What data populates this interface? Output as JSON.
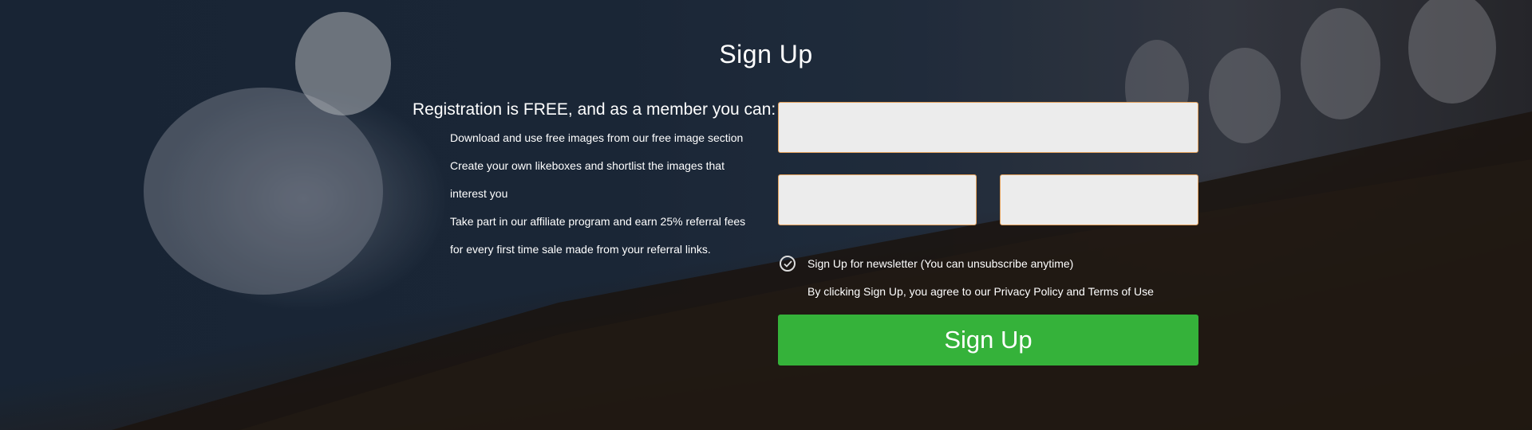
{
  "page": {
    "title": "Sign Up"
  },
  "benefits": {
    "heading": "Registration is FREE, and as a member you can:",
    "items": [
      "Download and use free images from our free image section",
      "Create your own likeboxes and shortlist the images that interest you",
      "Take part in our affiliate program and earn 25% referral fees for every first time sale made from your referral links."
    ]
  },
  "form": {
    "email": {
      "value": "",
      "placeholder": ""
    },
    "first_name": {
      "value": "",
      "placeholder": ""
    },
    "last_name": {
      "value": "",
      "placeholder": ""
    },
    "newsletter_label": "Sign Up for newsletter (You can unsubscribe anytime)",
    "newsletter_checked": true,
    "terms_text": "By clicking Sign Up, you agree to our Privacy Policy and Terms of Use",
    "submit_label": "Sign Up"
  },
  "colors": {
    "submit": "#35b23a",
    "input_border": "#e3a05a",
    "input_bg": "#ececec"
  },
  "icons": {
    "checkbox": "check-circle-icon"
  }
}
